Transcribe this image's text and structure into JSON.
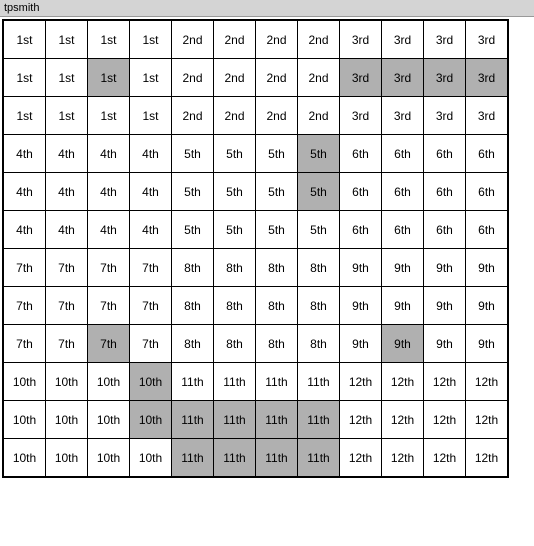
{
  "title": "tpsmith",
  "grid": {
    "rows": [
      [
        {
          "text": "1st",
          "bg": "normal"
        },
        {
          "text": "1st",
          "bg": "normal"
        },
        {
          "text": "1st",
          "bg": "normal"
        },
        {
          "text": "1st",
          "bg": "normal"
        },
        {
          "text": "2nd",
          "bg": "normal"
        },
        {
          "text": "2nd",
          "bg": "normal"
        },
        {
          "text": "2nd",
          "bg": "normal"
        },
        {
          "text": "2nd",
          "bg": "normal"
        },
        {
          "text": "3rd",
          "bg": "normal"
        },
        {
          "text": "3rd",
          "bg": "normal"
        },
        {
          "text": "3rd",
          "bg": "normal"
        },
        {
          "text": "3rd",
          "bg": "normal"
        }
      ],
      [
        {
          "text": "1st",
          "bg": "normal"
        },
        {
          "text": "1st",
          "bg": "normal"
        },
        {
          "text": "1st",
          "bg": "highlighted"
        },
        {
          "text": "1st",
          "bg": "normal"
        },
        {
          "text": "2nd",
          "bg": "normal"
        },
        {
          "text": "2nd",
          "bg": "normal"
        },
        {
          "text": "2nd",
          "bg": "normal"
        },
        {
          "text": "2nd",
          "bg": "normal"
        },
        {
          "text": "3rd",
          "bg": "highlighted"
        },
        {
          "text": "3rd",
          "bg": "highlighted"
        },
        {
          "text": "3rd",
          "bg": "highlighted"
        },
        {
          "text": "3rd",
          "bg": "highlighted"
        }
      ],
      [
        {
          "text": "1st",
          "bg": "normal"
        },
        {
          "text": "1st",
          "bg": "normal"
        },
        {
          "text": "1st",
          "bg": "normal"
        },
        {
          "text": "1st",
          "bg": "normal"
        },
        {
          "text": "2nd",
          "bg": "normal"
        },
        {
          "text": "2nd",
          "bg": "normal"
        },
        {
          "text": "2nd",
          "bg": "normal"
        },
        {
          "text": "2nd",
          "bg": "normal"
        },
        {
          "text": "3rd",
          "bg": "normal"
        },
        {
          "text": "3rd",
          "bg": "normal"
        },
        {
          "text": "3rd",
          "bg": "normal"
        },
        {
          "text": "3rd",
          "bg": "normal"
        }
      ],
      [
        {
          "text": "4th",
          "bg": "normal"
        },
        {
          "text": "4th",
          "bg": "normal"
        },
        {
          "text": "4th",
          "bg": "normal"
        },
        {
          "text": "4th",
          "bg": "normal"
        },
        {
          "text": "5th",
          "bg": "normal"
        },
        {
          "text": "5th",
          "bg": "normal"
        },
        {
          "text": "5th",
          "bg": "normal"
        },
        {
          "text": "5th",
          "bg": "highlighted"
        },
        {
          "text": "6th",
          "bg": "normal"
        },
        {
          "text": "6th",
          "bg": "normal"
        },
        {
          "text": "6th",
          "bg": "normal"
        },
        {
          "text": "6th",
          "bg": "normal"
        }
      ],
      [
        {
          "text": "4th",
          "bg": "normal"
        },
        {
          "text": "4th",
          "bg": "normal"
        },
        {
          "text": "4th",
          "bg": "normal"
        },
        {
          "text": "4th",
          "bg": "normal"
        },
        {
          "text": "5th",
          "bg": "normal"
        },
        {
          "text": "5th",
          "bg": "normal"
        },
        {
          "text": "5th",
          "bg": "normal"
        },
        {
          "text": "5th",
          "bg": "highlighted"
        },
        {
          "text": "6th",
          "bg": "normal"
        },
        {
          "text": "6th",
          "bg": "normal"
        },
        {
          "text": "6th",
          "bg": "normal"
        },
        {
          "text": "6th",
          "bg": "normal"
        }
      ],
      [
        {
          "text": "4th",
          "bg": "normal"
        },
        {
          "text": "4th",
          "bg": "normal"
        },
        {
          "text": "4th",
          "bg": "normal"
        },
        {
          "text": "4th",
          "bg": "normal"
        },
        {
          "text": "5th",
          "bg": "normal"
        },
        {
          "text": "5th",
          "bg": "normal"
        },
        {
          "text": "5th",
          "bg": "normal"
        },
        {
          "text": "5th",
          "bg": "normal"
        },
        {
          "text": "6th",
          "bg": "normal"
        },
        {
          "text": "6th",
          "bg": "normal"
        },
        {
          "text": "6th",
          "bg": "normal"
        },
        {
          "text": "6th",
          "bg": "normal"
        }
      ],
      [
        {
          "text": "7th",
          "bg": "normal"
        },
        {
          "text": "7th",
          "bg": "normal"
        },
        {
          "text": "7th",
          "bg": "normal"
        },
        {
          "text": "7th",
          "bg": "normal"
        },
        {
          "text": "8th",
          "bg": "normal"
        },
        {
          "text": "8th",
          "bg": "normal"
        },
        {
          "text": "8th",
          "bg": "normal"
        },
        {
          "text": "8th",
          "bg": "normal"
        },
        {
          "text": "9th",
          "bg": "normal"
        },
        {
          "text": "9th",
          "bg": "normal"
        },
        {
          "text": "9th",
          "bg": "normal"
        },
        {
          "text": "9th",
          "bg": "normal"
        }
      ],
      [
        {
          "text": "7th",
          "bg": "normal"
        },
        {
          "text": "7th",
          "bg": "normal"
        },
        {
          "text": "7th",
          "bg": "normal"
        },
        {
          "text": "7th",
          "bg": "normal"
        },
        {
          "text": "8th",
          "bg": "normal"
        },
        {
          "text": "8th",
          "bg": "normal"
        },
        {
          "text": "8th",
          "bg": "normal"
        },
        {
          "text": "8th",
          "bg": "normal"
        },
        {
          "text": "9th",
          "bg": "normal"
        },
        {
          "text": "9th",
          "bg": "normal"
        },
        {
          "text": "9th",
          "bg": "normal"
        },
        {
          "text": "9th",
          "bg": "normal"
        }
      ],
      [
        {
          "text": "7th",
          "bg": "normal"
        },
        {
          "text": "7th",
          "bg": "normal"
        },
        {
          "text": "7th",
          "bg": "highlighted"
        },
        {
          "text": "7th",
          "bg": "normal"
        },
        {
          "text": "8th",
          "bg": "normal"
        },
        {
          "text": "8th",
          "bg": "normal"
        },
        {
          "text": "8th",
          "bg": "normal"
        },
        {
          "text": "8th",
          "bg": "normal"
        },
        {
          "text": "9th",
          "bg": "normal"
        },
        {
          "text": "9th",
          "bg": "highlighted"
        },
        {
          "text": "9th",
          "bg": "normal"
        },
        {
          "text": "9th",
          "bg": "normal"
        }
      ],
      [
        {
          "text": "10th",
          "bg": "normal"
        },
        {
          "text": "10th",
          "bg": "normal"
        },
        {
          "text": "10th",
          "bg": "normal"
        },
        {
          "text": "10th",
          "bg": "highlighted"
        },
        {
          "text": "11th",
          "bg": "normal"
        },
        {
          "text": "11th",
          "bg": "normal"
        },
        {
          "text": "11th",
          "bg": "normal"
        },
        {
          "text": "11th",
          "bg": "normal"
        },
        {
          "text": "12th",
          "bg": "normal"
        },
        {
          "text": "12th",
          "bg": "normal"
        },
        {
          "text": "12th",
          "bg": "normal"
        },
        {
          "text": "12th",
          "bg": "normal"
        }
      ],
      [
        {
          "text": "10th",
          "bg": "normal"
        },
        {
          "text": "10th",
          "bg": "normal"
        },
        {
          "text": "10th",
          "bg": "normal"
        },
        {
          "text": "10th",
          "bg": "highlighted"
        },
        {
          "text": "11th",
          "bg": "highlighted"
        },
        {
          "text": "11th",
          "bg": "highlighted"
        },
        {
          "text": "11th",
          "bg": "highlighted"
        },
        {
          "text": "11th",
          "bg": "highlighted"
        },
        {
          "text": "12th",
          "bg": "normal"
        },
        {
          "text": "12th",
          "bg": "normal"
        },
        {
          "text": "12th",
          "bg": "normal"
        },
        {
          "text": "12th",
          "bg": "normal"
        }
      ],
      [
        {
          "text": "10th",
          "bg": "normal"
        },
        {
          "text": "10th",
          "bg": "normal"
        },
        {
          "text": "10th",
          "bg": "normal"
        },
        {
          "text": "10th",
          "bg": "normal"
        },
        {
          "text": "11th",
          "bg": "highlighted"
        },
        {
          "text": "11th",
          "bg": "highlighted"
        },
        {
          "text": "11th",
          "bg": "highlighted"
        },
        {
          "text": "11th",
          "bg": "highlighted"
        },
        {
          "text": "12th",
          "bg": "normal"
        },
        {
          "text": "12th",
          "bg": "normal"
        },
        {
          "text": "12th",
          "bg": "normal"
        },
        {
          "text": "12th",
          "bg": "normal"
        }
      ]
    ]
  }
}
